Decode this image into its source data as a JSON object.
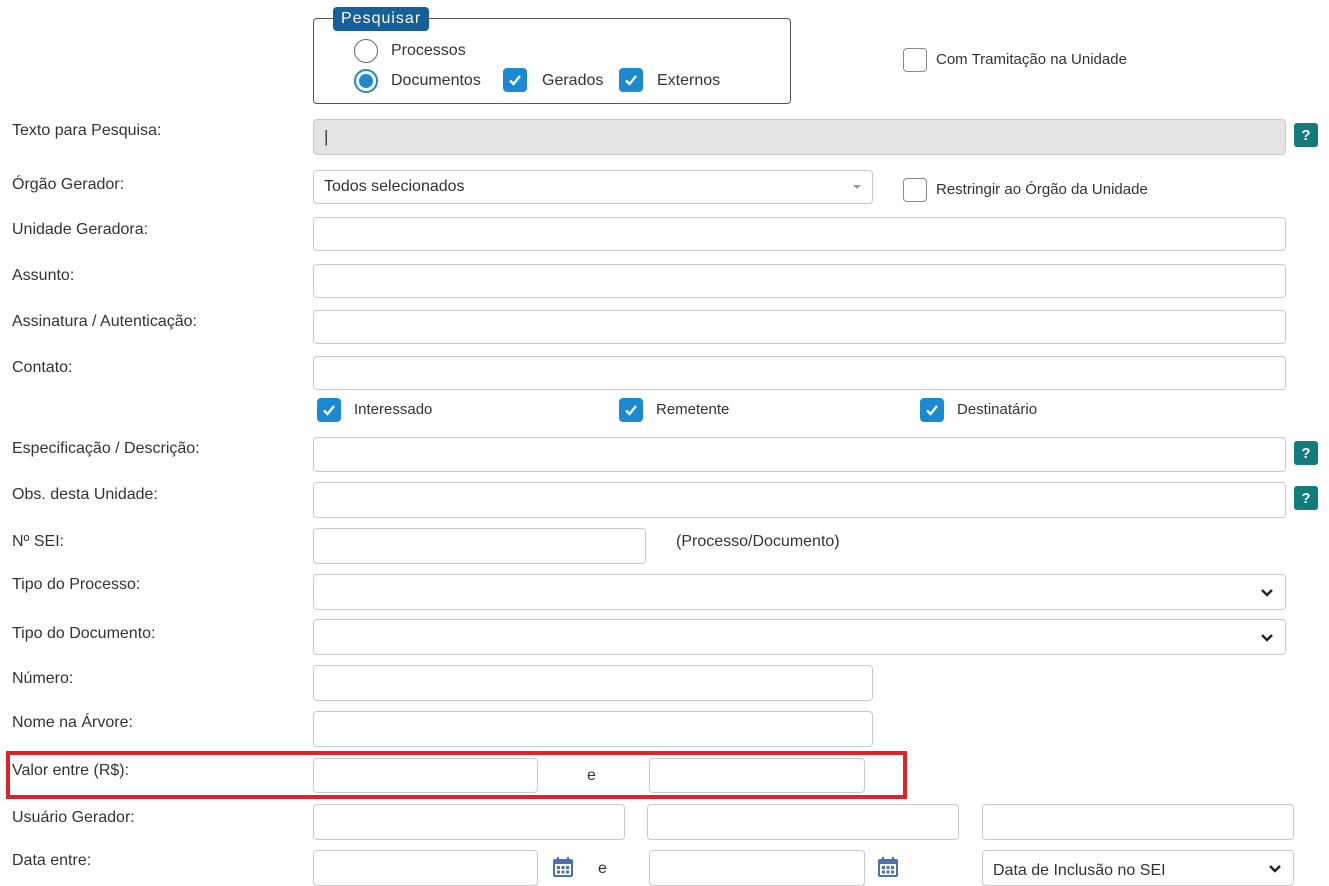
{
  "search_group": {
    "legend": "Pesquisar",
    "option_processos": "Processos",
    "option_documentos": "Documentos",
    "gerados": "Gerados",
    "externos": "Externos",
    "selected": "Documentos"
  },
  "com_tramitacao": "Com Tramitação na Unidade",
  "fields": {
    "texto_pesquisa": {
      "label": "Texto para Pesquisa:",
      "value": "|"
    },
    "orgao_gerador": {
      "label": "Órgão Gerador:",
      "value": "Todos selecionados"
    },
    "restringir_orgao": "Restringir ao Órgão da Unidade",
    "unidade_geradora": {
      "label": "Unidade Geradora:"
    },
    "assunto": {
      "label": "Assunto:"
    },
    "assinatura": {
      "label": "Assinatura / Autenticação:"
    },
    "contato": {
      "label": "Contato:"
    },
    "interessado": "Interessado",
    "remetente": "Remetente",
    "destinatario": "Destinatário",
    "especificacao": {
      "label": "Especificação / Descrição:"
    },
    "obs_unidade": {
      "label": "Obs. desta Unidade:"
    },
    "n_sei": {
      "label": "Nº SEI:",
      "hint": "(Processo/Documento)"
    },
    "tipo_processo": {
      "label": "Tipo do Processo:"
    },
    "tipo_documento": {
      "label": "Tipo do Documento:"
    },
    "numero": {
      "label": "Número:"
    },
    "nome_arvore": {
      "label": "Nome na Árvore:"
    },
    "valor_entre": {
      "label": "Valor entre (R$):",
      "sep": "e"
    },
    "usuario_gerador": {
      "label": "Usuário Gerador:"
    },
    "data_entre": {
      "label": "Data entre:",
      "sep": "e",
      "type_value": "Data de Inclusão no SEI"
    }
  },
  "help_glyph": "?",
  "colors": {
    "accent": "#1c8ad3",
    "legend_bg": "#155f9a",
    "help_bg": "#127c7a",
    "highlight": "#e0222c",
    "disabled_input": "#e4e4e4"
  },
  "icons": [
    "check-icon",
    "help-icon",
    "chevron-down-icon",
    "calendar-icon"
  ]
}
